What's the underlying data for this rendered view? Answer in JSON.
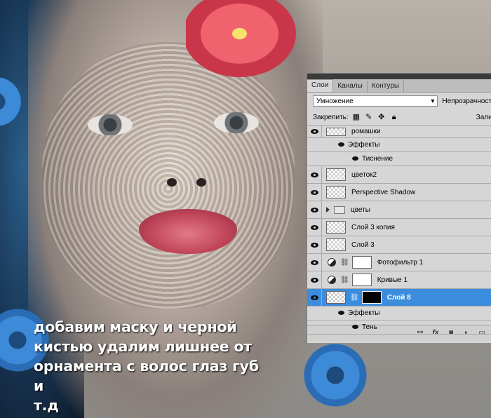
{
  "caption": {
    "lines": [
      "добавим маску и черной",
      "кистью удалим лишнее от",
      "орнамента с волос глаз губ и",
      "т.д"
    ]
  },
  "panel": {
    "tabs": [
      {
        "label": "Слои",
        "active": true
      },
      {
        "label": "Каналы",
        "active": false
      },
      {
        "label": "Контуры",
        "active": false
      }
    ],
    "blend_mode": "Умножение",
    "opacity_label": "Непрозрачност",
    "lock_label": "Закрепить:",
    "fill_label": "Залив",
    "layers": [
      {
        "name": "ромашки",
        "kind": "layer"
      },
      {
        "name": "Эффекты",
        "kind": "effects"
      },
      {
        "name": "Тиснение",
        "kind": "effect"
      },
      {
        "name": "цветок2",
        "kind": "layer"
      },
      {
        "name": "Perspective Shadow",
        "kind": "layer"
      },
      {
        "name": "цветы",
        "kind": "group"
      },
      {
        "name": "Слой 3 копия",
        "kind": "layer"
      },
      {
        "name": "Слой 3",
        "kind": "layer"
      },
      {
        "name": "Фотофильтр 1",
        "kind": "adjustment"
      },
      {
        "name": "Кривые 1",
        "kind": "adjustment"
      },
      {
        "name": "Слой 8",
        "kind": "masked-layer",
        "selected": true
      },
      {
        "name": "Эффекты",
        "kind": "effects"
      },
      {
        "name": "Тень",
        "kind": "effect"
      }
    ],
    "bottom_icons": [
      "link-icon",
      "fx-icon",
      "mask-icon",
      "adjustment-icon",
      "folder-icon"
    ],
    "selected_color": "#3c8ddd"
  }
}
